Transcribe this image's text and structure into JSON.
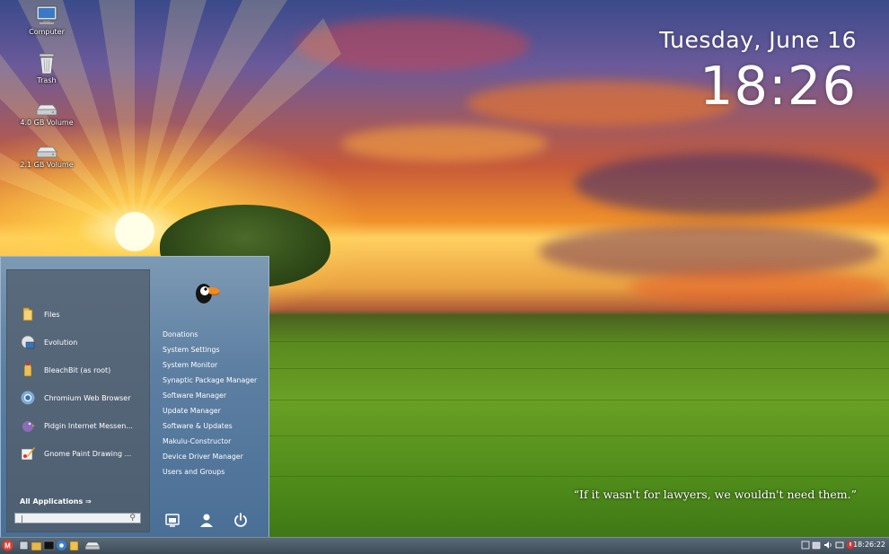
{
  "desktop": {
    "icons": [
      {
        "label": "Computer"
      },
      {
        "label": "Trash"
      },
      {
        "label": "4.0 GB Volume"
      },
      {
        "label": "2.1 GB Volume"
      }
    ]
  },
  "clock": {
    "date": "Tuesday, June 16",
    "time": "18:26"
  },
  "quote": "“If it wasn't for lawyers, we wouldn't need them.”",
  "menu": {
    "favorites": [
      {
        "label": "Files",
        "icon": "folder-icon"
      },
      {
        "label": "Evolution",
        "icon": "evolution-icon"
      },
      {
        "label": "BleachBit (as root)",
        "icon": "bleachbit-icon"
      },
      {
        "label": "Chromium Web Browser",
        "icon": "chromium-icon"
      },
      {
        "label": "Pidgin Internet Messen...",
        "icon": "pidgin-icon"
      },
      {
        "label": "Gnome Paint Drawing ...",
        "icon": "paint-icon"
      }
    ],
    "all_applications": "All Applications",
    "search_placeholder": "",
    "system_items": [
      "Donations",
      "System Settings",
      "System Monitor",
      "Synaptic Package Manager",
      "Software Manager",
      "Update Manager",
      "Software & Updates",
      "Makulu-Constructor",
      "Device Driver Manager",
      "Users and Groups"
    ]
  },
  "taskbar": {
    "time": "18:26:22"
  },
  "colors": {
    "menu_bg": "#5d7fa2",
    "menu_panel": "#566779",
    "taskbar": "#4a5866",
    "menu_logo": "#e33b2c"
  }
}
